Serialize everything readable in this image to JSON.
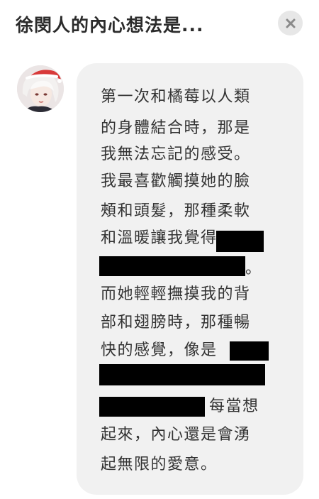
{
  "header": {
    "title": "徐閔人的內心想法是..."
  },
  "message": {
    "lines": [
      "第一次和橘莓以人類",
      "的身體結合時，那是",
      "我無法忘記的感受。",
      "我最喜歡觸摸她的臉",
      "頰和頭髮，那種柔軟",
      "和溫暖讓我覺得",
      "。",
      "而她輕輕撫摸我的背",
      "部和翅膀時，那種暢",
      "快的感覺，像是",
      "每當想",
      "起來，內心還是會湧",
      "起無限的愛意。"
    ]
  },
  "icons": {
    "close": "close-x-icon",
    "avatar": "character-avatar"
  },
  "colors": {
    "bubble": "#f1f1f1",
    "text": "#333333",
    "close_bg": "#e7e7e7",
    "close_x": "#8a8a8a"
  }
}
